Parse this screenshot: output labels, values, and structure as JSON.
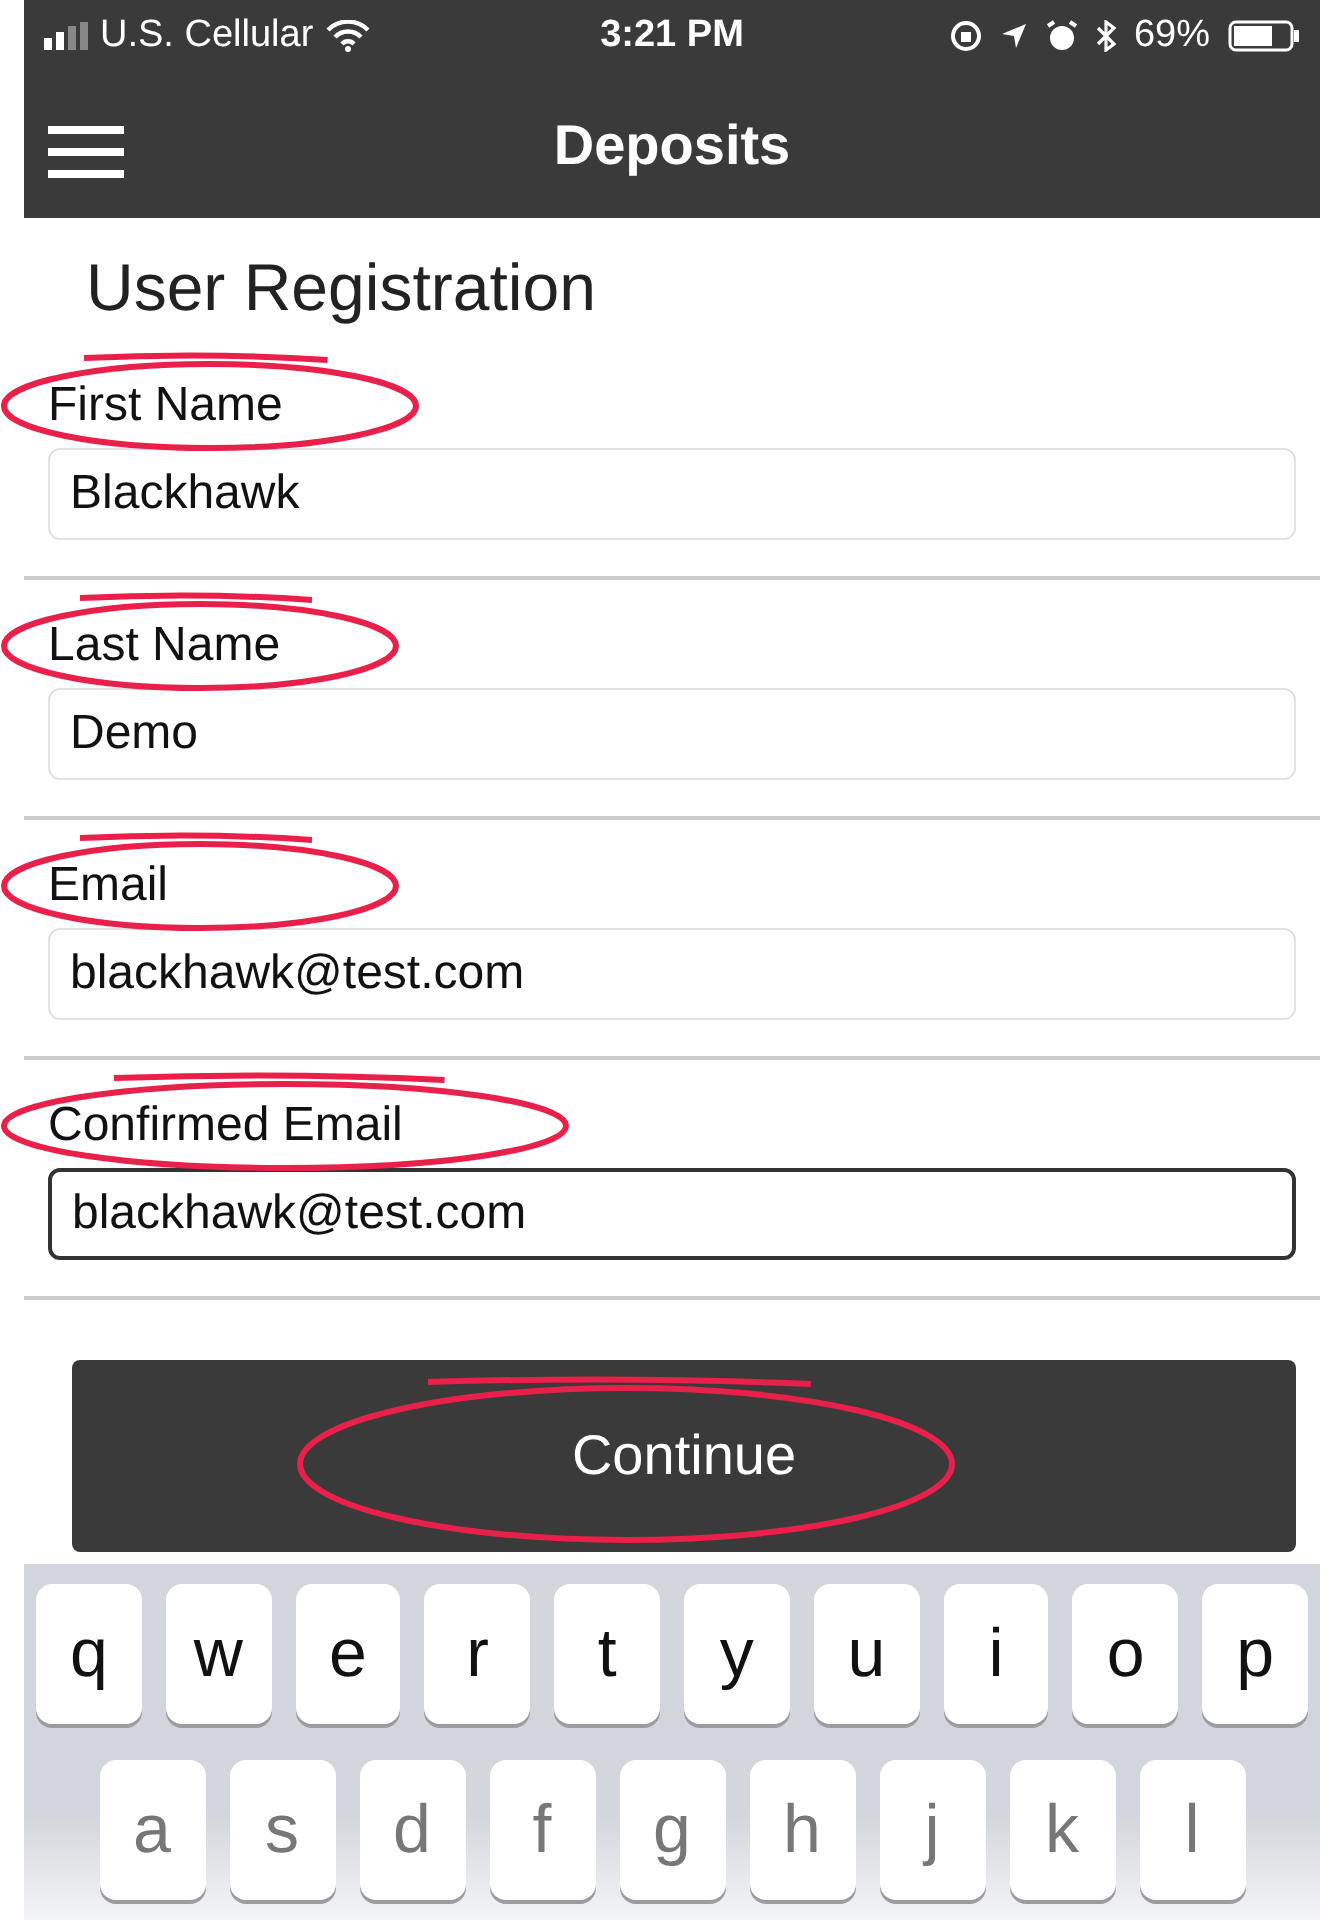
{
  "status_bar": {
    "carrier": "U.S. Cellular",
    "time": "3:21 PM",
    "battery": "69%"
  },
  "nav_bar": {
    "title": "Deposits"
  },
  "heading": "User Registration",
  "fields": [
    {
      "label": "First Name",
      "value": "Blackhawk",
      "focused": false,
      "circled": true
    },
    {
      "label": "Last Name",
      "value": "Demo",
      "focused": false,
      "circled": true
    },
    {
      "label": "Email",
      "value": "blackhawk@test.com",
      "focused": false,
      "circled": true
    },
    {
      "label": "Confirmed Email",
      "value": "blackhawk@test.com",
      "focused": true,
      "circled": true
    }
  ],
  "continue_button": {
    "label": "Continue",
    "circled": true
  },
  "keyboard": {
    "rows": [
      [
        "q",
        "w",
        "e",
        "r",
        "t",
        "y",
        "u",
        "i",
        "o",
        "p"
      ],
      [
        "a",
        "s",
        "d",
        "f",
        "g",
        "h",
        "j",
        "k",
        "l"
      ]
    ]
  }
}
